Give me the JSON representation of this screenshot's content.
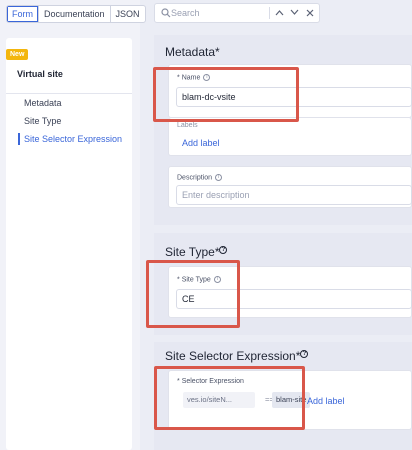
{
  "tabs": [
    {
      "label": "Form",
      "active": true
    },
    {
      "label": "Documentation",
      "active": false
    },
    {
      "label": "JSON",
      "active": false
    }
  ],
  "sidebar": {
    "badge": "New",
    "title": "Virtual site",
    "items": [
      {
        "label": "Metadata"
      },
      {
        "label": "Site Type"
      },
      {
        "label": "Site Selector Expression",
        "active": true
      }
    ]
  },
  "search": {
    "placeholder": "Search",
    "value": ""
  },
  "metadata": {
    "title": "Metadata",
    "required_mark": "*",
    "name_label": "Name",
    "name_required": "*",
    "name_value": "blam-dc-vsite",
    "labels_label": "Labels",
    "add_label": "Add label",
    "description_label": "Description",
    "description_placeholder": "Enter description"
  },
  "site_type": {
    "title": "Site Type",
    "required_mark": "*",
    "field_label": "Site Type",
    "field_required": "*",
    "value": "CE"
  },
  "selector": {
    "title": "Site Selector Expression",
    "required_mark": "*",
    "field_label": "Selector Expression",
    "field_required": "*",
    "key": "ves.io/siteN...",
    "operator": "==",
    "value": "blam-site",
    "add_label": "Add label"
  },
  "colors": {
    "accent": "#3a66d9",
    "badge": "#f3b60d",
    "highlight": "#d9574a"
  }
}
